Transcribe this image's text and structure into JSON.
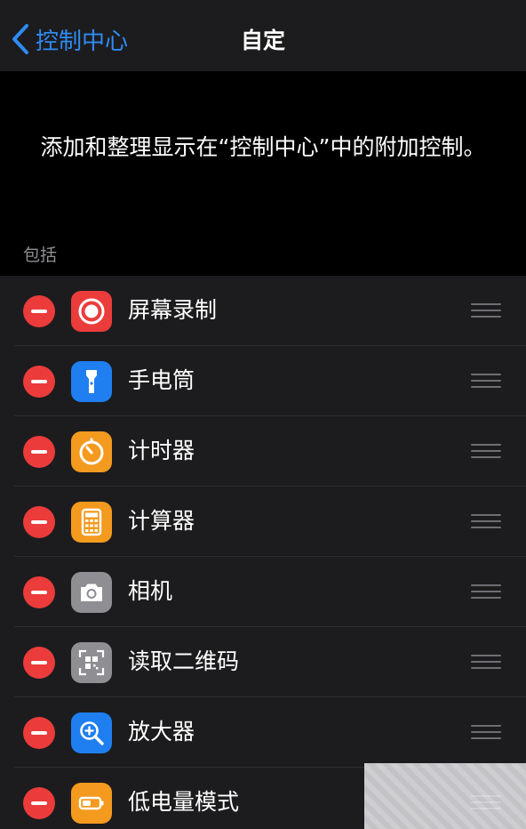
{
  "navbar": {
    "back_label": "控制中心",
    "title": "自定"
  },
  "header": {
    "description": "添加和整理显示在“控制中心”中的附加控制。"
  },
  "section": {
    "label": "包括"
  },
  "colors": {
    "accent": "#2f8bf3",
    "remove": "#eb3b3b",
    "background": "#000000",
    "row_background": "#1c1c1e"
  },
  "items": [
    {
      "label": "屏幕录制",
      "icon": "screen-record-icon",
      "icon_bg": "#ea3c3b"
    },
    {
      "label": "手电筒",
      "icon": "flashlight-icon",
      "icon_bg": "#1f7ff0"
    },
    {
      "label": "计时器",
      "icon": "timer-icon",
      "icon_bg": "#f39a1f"
    },
    {
      "label": "计算器",
      "icon": "calculator-icon",
      "icon_bg": "#f39a1f"
    },
    {
      "label": "相机",
      "icon": "camera-icon",
      "icon_bg": "#8e8e93"
    },
    {
      "label": "读取二维码",
      "icon": "qr-code-icon",
      "icon_bg": "#8e8e93"
    },
    {
      "label": "放大器",
      "icon": "magnifier-icon",
      "icon_bg": "#1f7ff0"
    },
    {
      "label": "低电量模式",
      "icon": "low-power-mode-icon",
      "icon_bg": "#f39a1f"
    }
  ]
}
